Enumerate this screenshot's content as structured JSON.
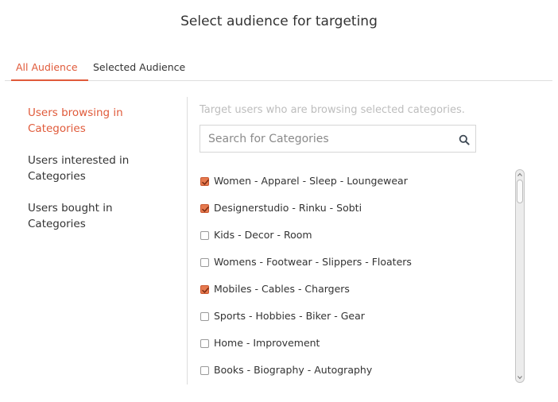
{
  "header": {
    "title": "Select audience for targeting"
  },
  "tabs": [
    {
      "label": "All Audience",
      "active": true
    },
    {
      "label": "Selected Audience",
      "active": false
    }
  ],
  "sidebar": {
    "items": [
      {
        "label": "Users browsing in Categories",
        "active": true
      },
      {
        "label": "Users interested in Categories",
        "active": false
      },
      {
        "label": "Users bought in Categories",
        "active": false
      }
    ]
  },
  "main": {
    "hint": "Target users who are browsing selected categories.",
    "search": {
      "placeholder": "Search for Categories",
      "value": ""
    },
    "categories": [
      {
        "label": "Women - Apparel - Sleep - Loungewear",
        "checked": true
      },
      {
        "label": "Designerstudio - Rinku - Sobti",
        "checked": true
      },
      {
        "label": "Kids - Decor - Room",
        "checked": false
      },
      {
        "label": "Womens - Footwear - Slippers - Floaters",
        "checked": false
      },
      {
        "label": "Mobiles - Cables - Chargers",
        "checked": true
      },
      {
        "label": "Sports - Hobbies - Biker - Gear",
        "checked": false
      },
      {
        "label": "Home - Improvement",
        "checked": false
      },
      {
        "label": "Books - Biography - Autography",
        "checked": false
      }
    ]
  },
  "colors": {
    "accent": "#e05a3a",
    "checkbox_checked": "#e67a4f"
  },
  "icons": {
    "search": "search-icon",
    "check": "check-icon"
  }
}
